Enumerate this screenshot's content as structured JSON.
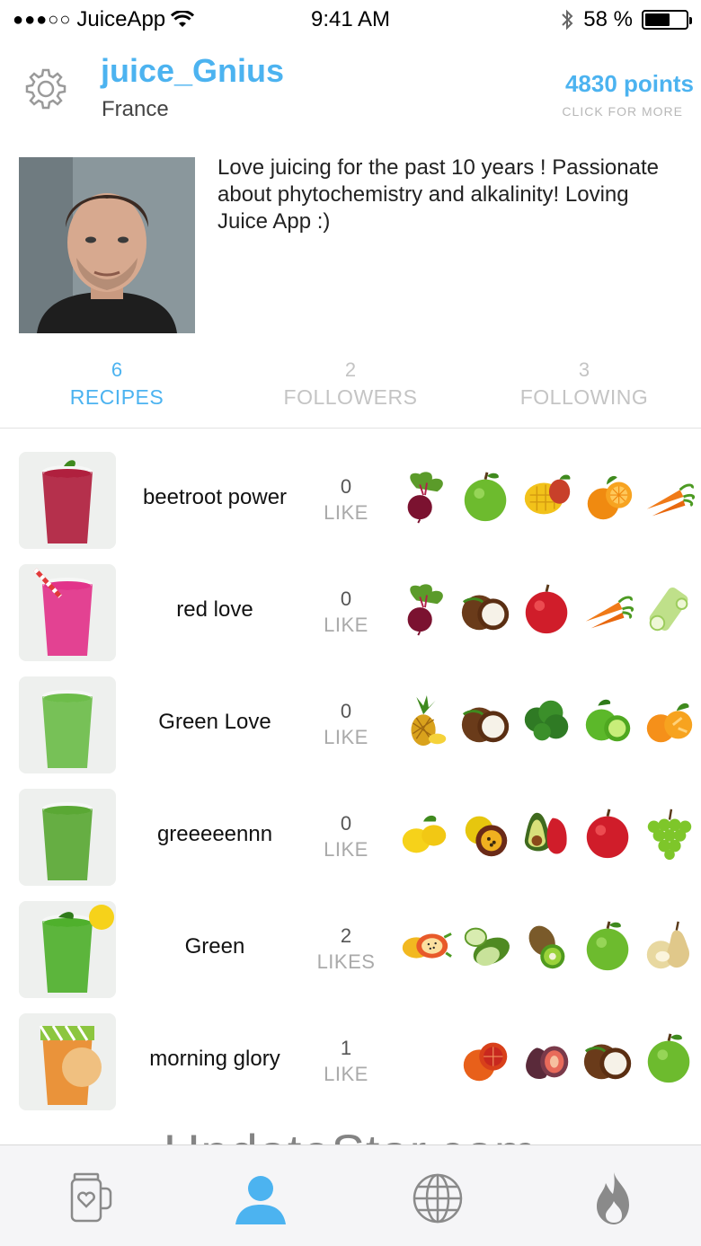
{
  "status_bar": {
    "carrier": "JuiceApp",
    "signal_dots": "●●●○○",
    "time": "9:41 AM",
    "battery": "58 %"
  },
  "profile": {
    "username": "juice_Gnius",
    "country": "France",
    "points": "4830 points",
    "points_hint": "CLICK FOR MORE",
    "bio": "Love juicing for the past 10 years ! Passionate about phytochemistry and alkalinity! Loving Juice App :)"
  },
  "tabs": [
    {
      "count": "6",
      "label": "RECIPES",
      "active": true
    },
    {
      "count": "2",
      "label": "FOLLOWERS",
      "active": false
    },
    {
      "count": "3",
      "label": "FOLLOWING",
      "active": false
    }
  ],
  "recipes": [
    {
      "name": "beetroot power",
      "likes": "0",
      "likes_label": "LIKE",
      "drink_color": "#b0203e",
      "ingredients": [
        "beetroot-icon",
        "green-apple-icon",
        "mango-icon",
        "orange-icon",
        "carrot-icon"
      ]
    },
    {
      "name": "red love",
      "likes": "0",
      "likes_label": "LIKE",
      "drink_color": "#e2338a",
      "ingredients": [
        "beetroot-icon",
        "coconut-icon",
        "red-apple-icon",
        "carrot-icon",
        "celery-icon"
      ]
    },
    {
      "name": "Green Love",
      "likes": "0",
      "likes_label": "LIKE",
      "drink_color": "#6dbd4a",
      "ingredients": [
        "pineapple-icon",
        "coconut-icon",
        "kale-icon",
        "lime-icon",
        "tangerine-icon"
      ]
    },
    {
      "name": "greeeeennn",
      "likes": "0",
      "likes_label": "LIKE",
      "drink_color": "#5aa834",
      "ingredients": [
        "lemon-icon",
        "passion-fruit-icon",
        "avocado-icon",
        "red-apple-icon",
        "grapes-icon"
      ]
    },
    {
      "name": "Green",
      "likes": "2",
      "likes_label": "LIKES",
      "drink_color": "#4fb02c",
      "ingredients": [
        "dragon-fruit-icon",
        "cucumber-icon",
        "kiwi-icon",
        "green-apple-icon",
        "pear-icon"
      ]
    },
    {
      "name": "morning glory",
      "likes": "1",
      "likes_label": "LIKE",
      "drink_color": "#e98b2a",
      "ingredients": [
        "blood-orange-icon",
        "fig-icon",
        "coconut-icon",
        "green-apple-icon"
      ]
    }
  ],
  "watermark": "UpdateStar.com",
  "bottom_nav": [
    {
      "icon": "juice-jar-icon",
      "active": false
    },
    {
      "icon": "profile-icon",
      "active": true
    },
    {
      "icon": "globe-icon",
      "active": false
    },
    {
      "icon": "flame-icon",
      "active": false
    }
  ],
  "colors": {
    "accent": "#4cb3f0",
    "inactive_tab": "#c4c4c4",
    "nav_inactive": "#8a8a8a"
  }
}
